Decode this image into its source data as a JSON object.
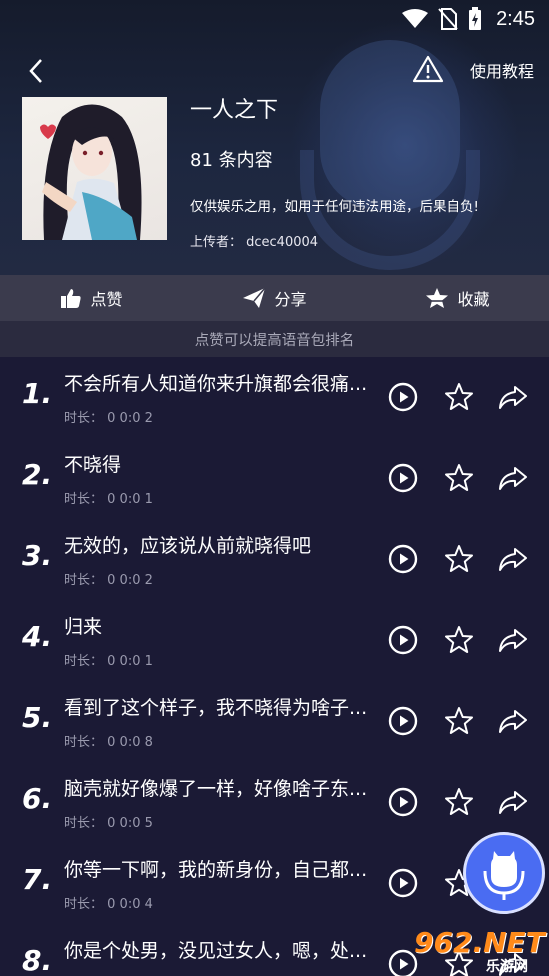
{
  "status": {
    "time": "2:45"
  },
  "topbar": {
    "tutorial_label": "使用教程"
  },
  "pack": {
    "title": "一人之下",
    "count": "81 条内容",
    "notice": "仅供娱乐之用，如用于任何违法用途，后果自负!",
    "uploader": "上传者： dcec40004"
  },
  "actions": {
    "like": "点赞",
    "share": "分享",
    "collect": "收藏"
  },
  "hint": "点赞可以提高语音包排名",
  "duration_label": "时长：",
  "items": [
    {
      "num": "1.",
      "title": "不会所有人知道你来升旗都会很痛...",
      "dur": "0 0:0 2"
    },
    {
      "num": "2.",
      "title": "不晓得",
      "dur": "0 0:0 1"
    },
    {
      "num": "3.",
      "title": "无效的，应该说从前就晓得吧",
      "dur": "0 0:0 2"
    },
    {
      "num": "4.",
      "title": "归来",
      "dur": "0 0:0 1"
    },
    {
      "num": "5.",
      "title": "看到了这个样子，我不晓得为啥子...",
      "dur": "0 0:0 8"
    },
    {
      "num": "6.",
      "title": "脑壳就好像爆了一样，好像啥子东...",
      "dur": "0 0:0 5"
    },
    {
      "num": "7.",
      "title": "你等一下啊，我的新身份，自己都...",
      "dur": "0 0:0 4"
    },
    {
      "num": "8.",
      "title": "你是个处男，没见过女人，嗯，处...",
      "dur": ""
    }
  ],
  "watermark": {
    "brand": "962.NET",
    "sub": "乐游网"
  },
  "colors": {
    "fab": "#4a6cf2",
    "actions_bg": "#3b3b4d",
    "list_bg": "#1b1a35"
  }
}
